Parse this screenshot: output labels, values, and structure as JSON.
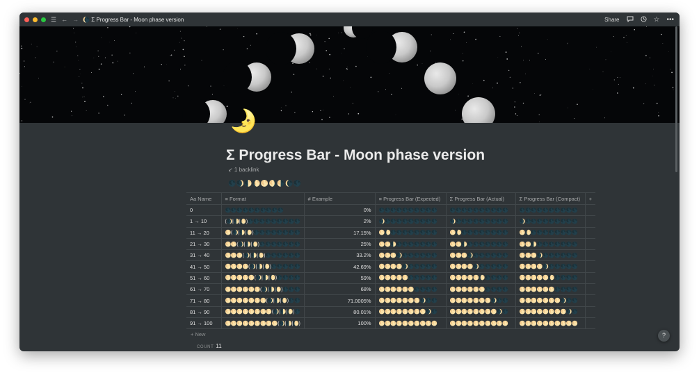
{
  "titlebar": {
    "breadcrumb": "Σ Progress Bar - Moon phase version",
    "page_icon": "🌘",
    "share": "Share"
  },
  "page": {
    "icon": "🌛",
    "title": "Σ Progress Bar - Moon phase version",
    "backlink": "↙ 1 backlink",
    "phase_row": "🌑🌒🌓🌔🌕🌖🌗🌘🌑"
  },
  "table": {
    "headers": [
      "Name",
      "Format",
      "Example",
      "Progress Bar (Expected)",
      "Progress Bar (Actual)",
      "Progress Bar (Compact)"
    ],
    "header_icons": [
      "Aa",
      "≡",
      "#",
      "≡",
      "Σ",
      "Σ"
    ],
    "rows": [
      {
        "name": "0",
        "format": "🌑🌑🌑🌑🌑🌑🌑🌑🌑🌑",
        "example": "0%",
        "expected": "🌑🌑🌑🌑🌑🌑🌑🌑🌑🌑",
        "actual": "🌑🌑🌑🌑🌑🌑🌑🌑🌑🌑",
        "compact": "🌑🌑🌑🌑🌑🌑🌑🌑🌑🌑"
      },
      {
        "name": "1 → 10",
        "format": "(🌒|🌓|🌔)🌑🌑🌑🌑🌑🌑🌑🌑🌑",
        "example": "2%",
        "expected": "🌒🌑🌑🌑🌑🌑🌑🌑🌑🌑",
        "actual": "🌒🌑🌑🌑🌑🌑🌑🌑🌑🌑",
        "compact": "🌒🌑🌑🌑🌑🌑🌑🌑🌑🌑"
      },
      {
        "name": "11 → 20",
        "format": "🌕(🌒|🌓|🌔)🌑🌑🌑🌑🌑🌑🌑🌑",
        "example": "17.15%",
        "expected": "🌕🌔🌑🌑🌑🌑🌑🌑🌑🌑",
        "actual": "🌕🌔🌑🌑🌑🌑🌑🌑🌑🌑",
        "compact": "🌕🌔🌑🌑🌑🌑🌑🌑🌑🌑"
      },
      {
        "name": "21 → 30",
        "format": "🌕🌕(🌒|🌓|🌔)🌑🌑🌑🌑🌑🌑🌑",
        "example": "25%",
        "expected": "🌕🌕🌓🌑🌑🌑🌑🌑🌑🌑",
        "actual": "🌕🌕🌓🌑🌑🌑🌑🌑🌑🌑",
        "compact": "🌕🌕🌓🌑🌑🌑🌑🌑🌑🌑"
      },
      {
        "name": "31 → 40",
        "format": "🌕🌕🌕(🌒|🌓|🌔)🌑🌑🌑🌑🌑🌑",
        "example": "33.2%",
        "expected": "🌕🌕🌕🌒🌑🌑🌑🌑🌑🌑",
        "actual": "🌕🌕🌕🌒🌑🌑🌑🌑🌑🌑",
        "compact": "🌕🌕🌕🌒🌑🌑🌑🌑🌑🌑"
      },
      {
        "name": "41 → 50",
        "format": "🌕🌕🌕🌕(🌒|🌓|🌔)🌑🌑🌑🌑🌑",
        "example": "42.69%",
        "expected": "🌕🌕🌕🌕🌒🌑🌑🌑🌑🌑",
        "actual": "🌕🌕🌕🌕🌒🌑🌑🌑🌑🌑",
        "compact": "🌕🌕🌕🌕🌒🌑🌑🌑🌑🌑"
      },
      {
        "name": "51 → 60",
        "format": "🌕🌕🌕🌕🌕(🌒|🌓|🌔)🌑🌑🌑🌑",
        "example": "59%",
        "expected": "🌕🌕🌕🌕🌕🌑🌑🌑🌑🌑",
        "actual": "🌕🌕🌕🌕🌕🌔🌑🌑🌑🌑",
        "compact": "🌕🌕🌕🌕🌕🌔🌑🌑🌑🌑"
      },
      {
        "name": "61 → 70",
        "format": "🌕🌕🌕🌕🌕🌕(🌒|🌓|🌔)🌑🌑🌑",
        "example": "68%",
        "expected": "🌕🌕🌕🌕🌕🌕🌑🌑🌑🌑",
        "actual": "🌕🌕🌕🌕🌕🌕🌑🌑🌑🌑",
        "compact": "🌕🌕🌕🌕🌕🌕🌑🌑🌑🌑"
      },
      {
        "name": "71 → 80",
        "format": "🌕🌕🌕🌕🌕🌕🌕(🌒|🌓|🌔)🌑🌑",
        "example": "71.0005%",
        "expected": "🌕🌕🌕🌕🌕🌕🌕🌒🌑🌑",
        "actual": "🌕🌕🌕🌕🌕🌕🌕🌒🌑🌑",
        "compact": "🌕🌕🌕🌕🌕🌕🌕🌒🌑🌑"
      },
      {
        "name": "81 → 90",
        "format": "🌕🌕🌕🌕🌕🌕🌕🌕(🌒|🌓|🌔)🌑",
        "example": "80.01%",
        "expected": "🌕🌕🌕🌕🌕🌕🌕🌕🌒🌑",
        "actual": "🌕🌕🌕🌕🌕🌕🌕🌕🌒🌑",
        "compact": "🌕🌕🌕🌕🌕🌕🌕🌕🌒🌑"
      },
      {
        "name": "91 → 100",
        "format": "🌕🌕🌕🌕🌕🌕🌕🌕🌕(🌒|🌓|🌔)",
        "example": "100%",
        "expected": "🌕🌕🌕🌕🌕🌕🌕🌕🌕🌕",
        "actual": "🌕🌕🌕🌕🌕🌕🌕🌕🌕🌕",
        "compact": "🌕🌕🌕🌕🌕🌕🌕🌕🌕🌕"
      }
    ],
    "new_label": "+ New",
    "count_label": "COUNT",
    "count_value": "11"
  },
  "help": "?",
  "colors": {
    "background": "#2f3437",
    "cover": "#050608",
    "text": "#ebebeb",
    "muted": "#a7a9aa",
    "grid": "#41474a",
    "traffic_close": "#ff5f57",
    "traffic_min": "#febc2e",
    "traffic_max": "#28c840"
  },
  "icons": [
    "menu-icon",
    "back-arrow-icon",
    "forward-arrow-icon",
    "comment-icon",
    "clock-icon",
    "star-icon",
    "more-icon",
    "plus-icon",
    "help-icon"
  ]
}
